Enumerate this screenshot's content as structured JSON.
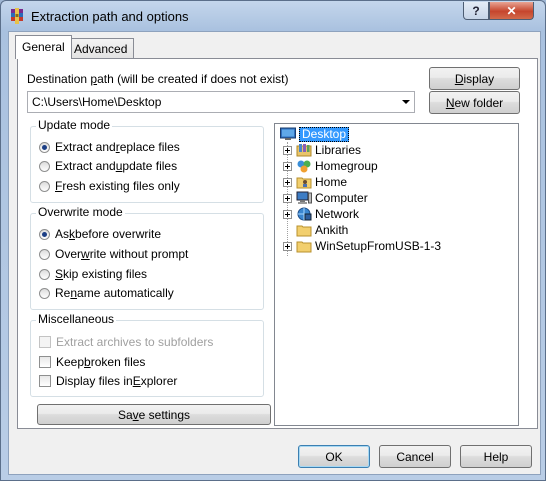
{
  "window": {
    "title": "Extraction path and options",
    "help_button": "?",
    "close_button": "✕"
  },
  "tabs": [
    {
      "label": "General",
      "active": true
    },
    {
      "label": "Advanced",
      "active": false
    }
  ],
  "destination": {
    "label_prefix": "Destination ",
    "label_accel": "p",
    "label_suffix": "ath (will be created if does not exist)",
    "value": "C:\\Users\\Home\\Desktop"
  },
  "buttons": {
    "display": {
      "accel": "D",
      "rest": "isplay"
    },
    "new_folder": {
      "pre": "",
      "accel": "N",
      "rest": "ew folder"
    },
    "save_settings": {
      "pre": "Sa",
      "accel": "v",
      "rest": "e settings"
    },
    "ok": "OK",
    "cancel": "Cancel",
    "help": "Help"
  },
  "update_mode": {
    "title": "Update mode",
    "options": [
      {
        "pre": "Extract and ",
        "accel": "r",
        "rest": "eplace files",
        "checked": true
      },
      {
        "pre": "Extract and ",
        "accel": "u",
        "rest": "pdate files",
        "checked": false
      },
      {
        "pre": "",
        "accel": "F",
        "rest": "resh existing files only",
        "checked": false
      }
    ]
  },
  "overwrite_mode": {
    "title": "Overwrite mode",
    "options": [
      {
        "pre": "As",
        "accel": "k",
        "rest": " before overwrite",
        "checked": true
      },
      {
        "pre": "Over",
        "accel": "w",
        "rest": "rite without prompt",
        "checked": false
      },
      {
        "pre": "",
        "accel": "S",
        "rest": "kip existing files",
        "checked": false
      },
      {
        "pre": "Re",
        "accel": "n",
        "rest": "ame automatically",
        "checked": false
      }
    ]
  },
  "misc": {
    "title": "Miscellaneous",
    "options": [
      {
        "pre": "Extract archives to subfolders",
        "accel": "",
        "rest": "",
        "checked": false,
        "disabled": true
      },
      {
        "pre": "Keep ",
        "accel": "b",
        "rest": "roken files",
        "checked": false,
        "disabled": false
      },
      {
        "pre": "Display files in ",
        "accel": "E",
        "rest": "xplorer",
        "checked": false,
        "disabled": false
      }
    ]
  },
  "tree": {
    "root": "Desktop",
    "items": [
      {
        "label": "Libraries",
        "icon": "libraries-icon",
        "expandable": true
      },
      {
        "label": "Homegroup",
        "icon": "homegroup-icon",
        "expandable": true
      },
      {
        "label": "Home",
        "icon": "user-folder-icon",
        "expandable": true
      },
      {
        "label": "Computer",
        "icon": "computer-icon",
        "expandable": true
      },
      {
        "label": "Network",
        "icon": "network-icon",
        "expandable": true
      },
      {
        "label": "Ankith",
        "icon": "folder-icon",
        "expandable": false
      },
      {
        "label": "WinSetupFromUSB-1-3",
        "icon": "folder-icon",
        "expandable": true
      }
    ]
  },
  "colors": {
    "selection": "#3399ff",
    "window_frame": "#b9cde6"
  }
}
